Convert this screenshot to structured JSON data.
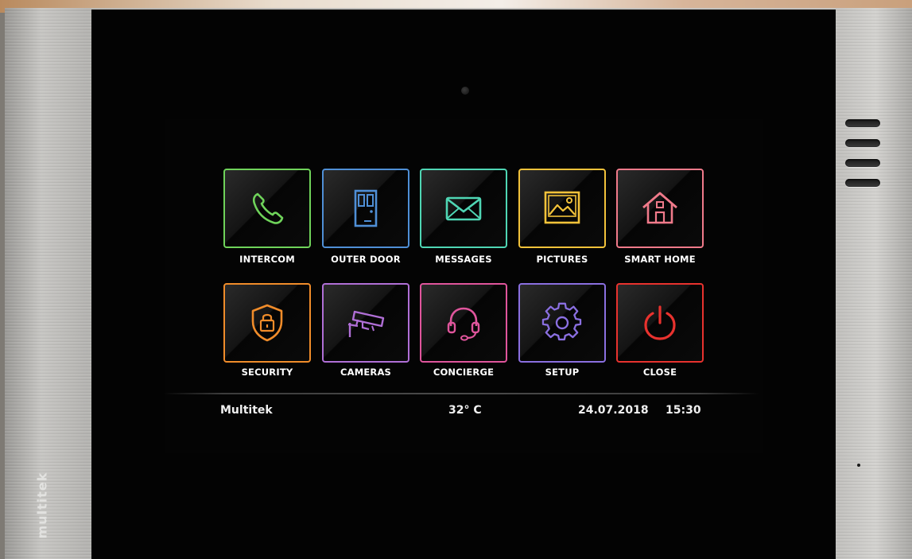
{
  "device": {
    "brand_mark": "multitek"
  },
  "menu": {
    "row1": [
      {
        "label": "INTERCOM",
        "icon": "phone-icon",
        "color": "#6fd35a"
      },
      {
        "label": "OUTER DOOR",
        "icon": "door-icon",
        "color": "#4f8fd6"
      },
      {
        "label": "MESSAGES",
        "icon": "envelope-icon",
        "color": "#4fd6b4"
      },
      {
        "label": "PICTURES",
        "icon": "picture-icon",
        "color": "#f2c23a"
      },
      {
        "label": "SMART HOME",
        "icon": "house-icon",
        "color": "#f07a8a"
      }
    ],
    "row2": [
      {
        "label": "SECURITY",
        "icon": "shield-lock-icon",
        "color": "#f08c2a"
      },
      {
        "label": "CAMERAS",
        "icon": "cctv-camera-icon",
        "color": "#b06fd6"
      },
      {
        "label": "CONCIERGE",
        "icon": "headset-icon",
        "color": "#e0559c"
      },
      {
        "label": "SETUP",
        "icon": "gear-icon",
        "color": "#8a6fe0"
      },
      {
        "label": "CLOSE",
        "icon": "power-icon",
        "color": "#e8322e"
      }
    ]
  },
  "status_bar": {
    "brand": "Multitek",
    "temperature": "32° C",
    "date": "24.07.2018",
    "time": "15:30"
  }
}
